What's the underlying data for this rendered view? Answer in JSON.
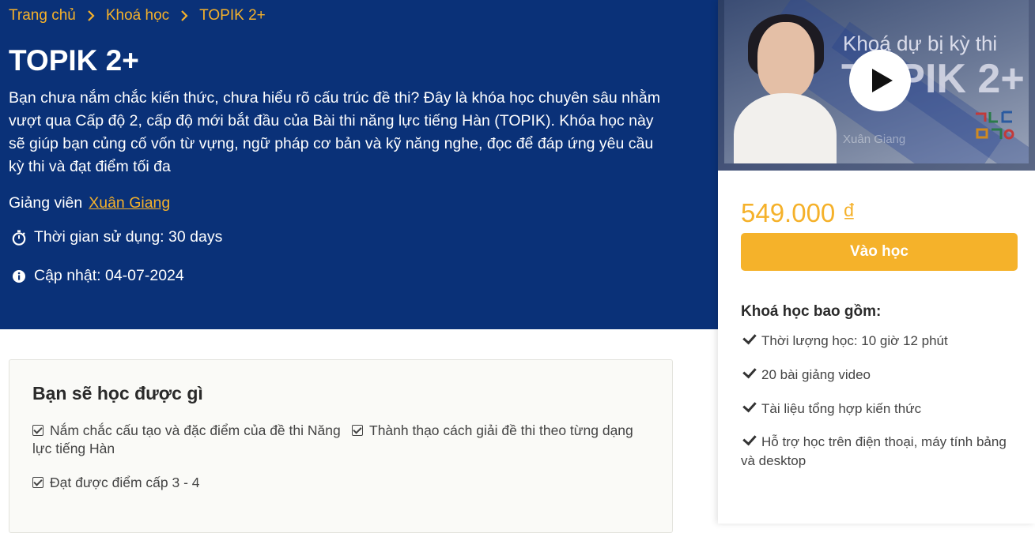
{
  "breadcrumb": {
    "items": [
      "Trang chủ",
      "Khoá học",
      "TOPIK 2+"
    ]
  },
  "course": {
    "title": "TOPIK 2+",
    "description": "Bạn chưa nắm chắc kiến thức, chưa hiểu rõ cấu trúc đề thi? Đây là khóa học chuyên sâu nhằm vượt qua Cấp độ 2, cấp độ mới bắt đầu của Bài thi năng lực tiếng Hàn (TOPIK). Khóa học này sẽ giúp bạn củng cố vốn từ vựng, ngữ pháp cơ bản và kỹ năng nghe, đọc để đáp ứng yêu cầu kỳ thi và đạt điểm tối đa",
    "instructor_label": "Giảng viên",
    "instructor_name": "Xuân Giang",
    "duration": "Thời gian sử dụng: 30 days",
    "updated": "Cập nhật: 04-07-2024"
  },
  "learn": {
    "title": "Bạn sẽ học được gì",
    "items": [
      "Nắm chắc cấu tạo và đặc điểm của đề thi Năng lực tiếng Hàn",
      "Thành thạo cách giải đề thi theo từng dạng",
      "Đạt được điểm cấp 3 - 4"
    ]
  },
  "video": {
    "overlay_title_line1": "Khoá dự bị kỳ thi",
    "overlay_title_line2": "TOPIK 2+",
    "overlay_author": "Xuân Giang"
  },
  "sidebar": {
    "price": "549.000 ₫",
    "enroll_label": "Vào học",
    "includes_title": "Khoá học bao gồm:",
    "includes": [
      "Thời lượng học: 10 giờ 12 phút",
      "20 bài giảng video",
      "Tài liệu tổng hợp kiến thức",
      "Hỗ trợ học trên điện thoại, máy tính bảng và desktop"
    ]
  },
  "colors": {
    "hero_bg": "#0a3178",
    "accent": "#f5b12a"
  }
}
